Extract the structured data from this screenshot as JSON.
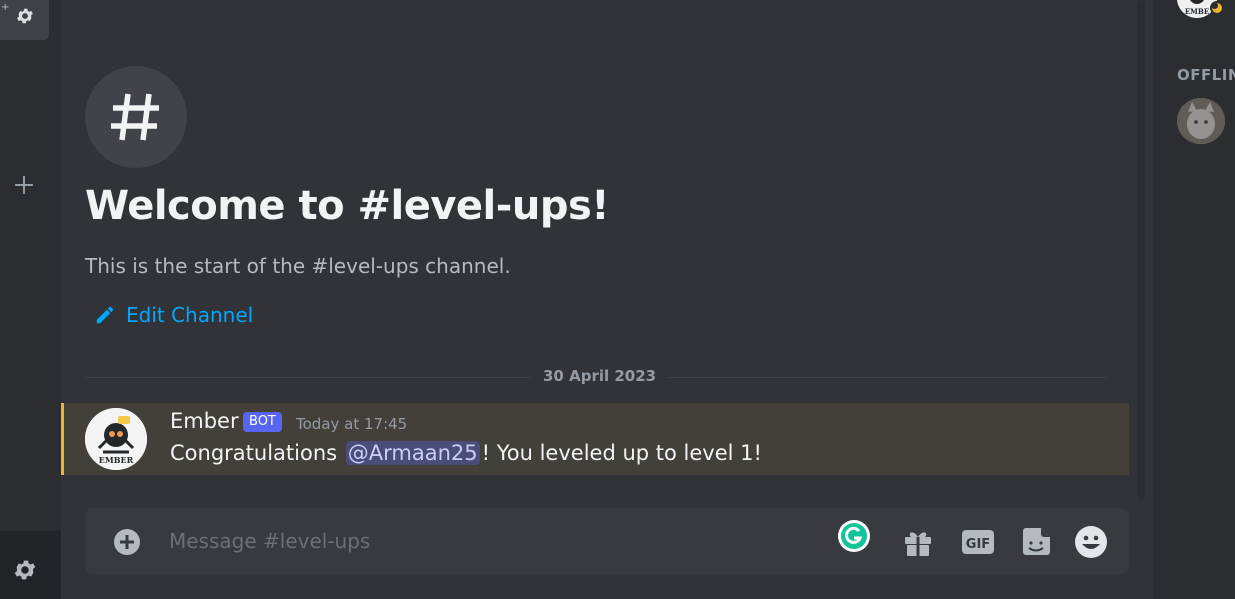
{
  "channel": {
    "welcome_title": "Welcome to #level-ups!",
    "start_text": "This is the start of the #level-ups channel.",
    "edit_label": "Edit Channel"
  },
  "divider": {
    "date": "30 April 2023"
  },
  "message": {
    "username": "Ember",
    "badge": "BOT",
    "timestamp": "Today at 17:45",
    "text_before": "Congratulations",
    "mention": "@Armaan25",
    "text_after": "! You leveled up to level 1!",
    "avatar_label": "EMBER",
    "highlight_color": "#f0b232"
  },
  "composer": {
    "placeholder": "Message #level-ups"
  },
  "composer_icons": [
    "grammarly-icon",
    "gift-icon",
    "gif-icon",
    "sticker-icon",
    "emoji-icon"
  ],
  "members": {
    "offline_header": "OFFLIN",
    "top_avatar_label": "EMBE"
  },
  "colors": {
    "accent": "#5865f2",
    "link": "#00a8fc",
    "background": "#313338"
  }
}
